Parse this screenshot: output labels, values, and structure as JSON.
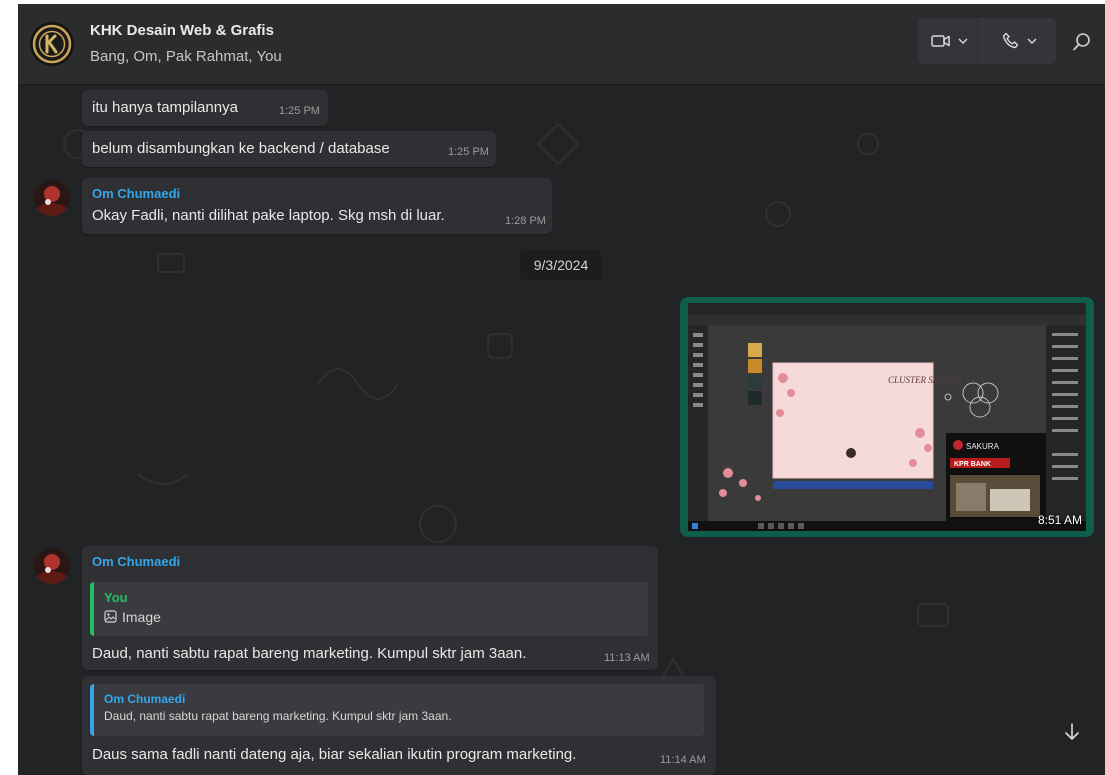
{
  "header": {
    "title": "KHK Desain Web & Grafis",
    "members": "Bang, Om, Pak Rahmat, You"
  },
  "messages": {
    "m1": {
      "text": "itu hanya tampilannya",
      "time": "1:25 PM"
    },
    "m2": {
      "text": "belum disambungkan ke backend / database",
      "time": "1:25 PM"
    },
    "m3": {
      "sender": "Om Chumaedi",
      "text": "Okay Fadli, nanti dilihat pake laptop. Skg msh di luar.",
      "time": "1:28 PM"
    },
    "date_divider": "9/3/2024",
    "m4": {
      "time": "8:51 AM"
    },
    "m5": {
      "sender": "Om Chumaedi",
      "quote_sender": "You",
      "quote_text": "Image",
      "text": "Daud, nanti sabtu rapat bareng marketing. Kumpul sktr jam 3aan.",
      "time": "11:13 AM"
    },
    "m6": {
      "quote_sender": "Om Chumaedi",
      "quote_text": "Daud, nanti sabtu rapat bareng marketing. Kumpul sktr jam 3aan.",
      "text": "Daus sama fadli nanti dateng aja, biar sekalian ikutin program marketing.",
      "time": "11:14 AM"
    }
  },
  "screenshot": {
    "card_title": "CLUSTER SAKURA",
    "promo_brand": "SAKURA",
    "promo_text": "KPR BANK"
  },
  "colors": {
    "sender": "#35a6ea",
    "quote_you": "#21c063",
    "image_frame": "#0f5e4c"
  }
}
